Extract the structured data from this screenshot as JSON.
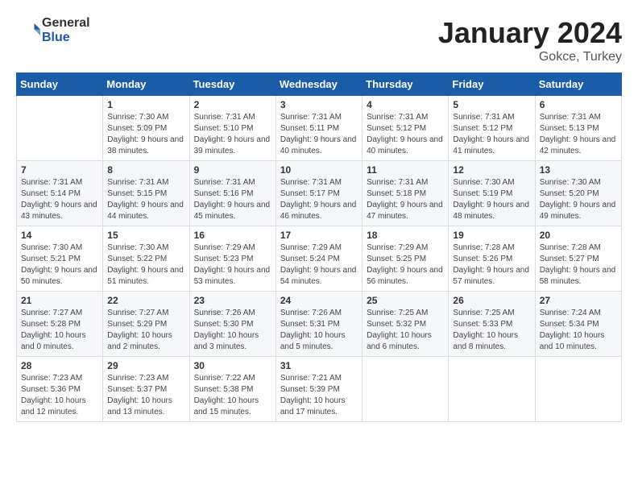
{
  "logo": {
    "general": "General",
    "blue": "Blue"
  },
  "header": {
    "month": "January 2024",
    "location": "Gokce, Turkey"
  },
  "weekdays": [
    "Sunday",
    "Monday",
    "Tuesday",
    "Wednesday",
    "Thursday",
    "Friday",
    "Saturday"
  ],
  "weeks": [
    [
      {
        "day": "",
        "sunrise": "",
        "sunset": "",
        "daylight": ""
      },
      {
        "day": "1",
        "sunrise": "Sunrise: 7:30 AM",
        "sunset": "Sunset: 5:09 PM",
        "daylight": "Daylight: 9 hours and 38 minutes."
      },
      {
        "day": "2",
        "sunrise": "Sunrise: 7:31 AM",
        "sunset": "Sunset: 5:10 PM",
        "daylight": "Daylight: 9 hours and 39 minutes."
      },
      {
        "day": "3",
        "sunrise": "Sunrise: 7:31 AM",
        "sunset": "Sunset: 5:11 PM",
        "daylight": "Daylight: 9 hours and 40 minutes."
      },
      {
        "day": "4",
        "sunrise": "Sunrise: 7:31 AM",
        "sunset": "Sunset: 5:12 PM",
        "daylight": "Daylight: 9 hours and 40 minutes."
      },
      {
        "day": "5",
        "sunrise": "Sunrise: 7:31 AM",
        "sunset": "Sunset: 5:12 PM",
        "daylight": "Daylight: 9 hours and 41 minutes."
      },
      {
        "day": "6",
        "sunrise": "Sunrise: 7:31 AM",
        "sunset": "Sunset: 5:13 PM",
        "daylight": "Daylight: 9 hours and 42 minutes."
      }
    ],
    [
      {
        "day": "7",
        "sunrise": "Sunrise: 7:31 AM",
        "sunset": "Sunset: 5:14 PM",
        "daylight": "Daylight: 9 hours and 43 minutes."
      },
      {
        "day": "8",
        "sunrise": "Sunrise: 7:31 AM",
        "sunset": "Sunset: 5:15 PM",
        "daylight": "Daylight: 9 hours and 44 minutes."
      },
      {
        "day": "9",
        "sunrise": "Sunrise: 7:31 AM",
        "sunset": "Sunset: 5:16 PM",
        "daylight": "Daylight: 9 hours and 45 minutes."
      },
      {
        "day": "10",
        "sunrise": "Sunrise: 7:31 AM",
        "sunset": "Sunset: 5:17 PM",
        "daylight": "Daylight: 9 hours and 46 minutes."
      },
      {
        "day": "11",
        "sunrise": "Sunrise: 7:31 AM",
        "sunset": "Sunset: 5:18 PM",
        "daylight": "Daylight: 9 hours and 47 minutes."
      },
      {
        "day": "12",
        "sunrise": "Sunrise: 7:30 AM",
        "sunset": "Sunset: 5:19 PM",
        "daylight": "Daylight: 9 hours and 48 minutes."
      },
      {
        "day": "13",
        "sunrise": "Sunrise: 7:30 AM",
        "sunset": "Sunset: 5:20 PM",
        "daylight": "Daylight: 9 hours and 49 minutes."
      }
    ],
    [
      {
        "day": "14",
        "sunrise": "Sunrise: 7:30 AM",
        "sunset": "Sunset: 5:21 PM",
        "daylight": "Daylight: 9 hours and 50 minutes."
      },
      {
        "day": "15",
        "sunrise": "Sunrise: 7:30 AM",
        "sunset": "Sunset: 5:22 PM",
        "daylight": "Daylight: 9 hours and 51 minutes."
      },
      {
        "day": "16",
        "sunrise": "Sunrise: 7:29 AM",
        "sunset": "Sunset: 5:23 PM",
        "daylight": "Daylight: 9 hours and 53 minutes."
      },
      {
        "day": "17",
        "sunrise": "Sunrise: 7:29 AM",
        "sunset": "Sunset: 5:24 PM",
        "daylight": "Daylight: 9 hours and 54 minutes."
      },
      {
        "day": "18",
        "sunrise": "Sunrise: 7:29 AM",
        "sunset": "Sunset: 5:25 PM",
        "daylight": "Daylight: 9 hours and 56 minutes."
      },
      {
        "day": "19",
        "sunrise": "Sunrise: 7:28 AM",
        "sunset": "Sunset: 5:26 PM",
        "daylight": "Daylight: 9 hours and 57 minutes."
      },
      {
        "day": "20",
        "sunrise": "Sunrise: 7:28 AM",
        "sunset": "Sunset: 5:27 PM",
        "daylight": "Daylight: 9 hours and 58 minutes."
      }
    ],
    [
      {
        "day": "21",
        "sunrise": "Sunrise: 7:27 AM",
        "sunset": "Sunset: 5:28 PM",
        "daylight": "Daylight: 10 hours and 0 minutes."
      },
      {
        "day": "22",
        "sunrise": "Sunrise: 7:27 AM",
        "sunset": "Sunset: 5:29 PM",
        "daylight": "Daylight: 10 hours and 2 minutes."
      },
      {
        "day": "23",
        "sunrise": "Sunrise: 7:26 AM",
        "sunset": "Sunset: 5:30 PM",
        "daylight": "Daylight: 10 hours and 3 minutes."
      },
      {
        "day": "24",
        "sunrise": "Sunrise: 7:26 AM",
        "sunset": "Sunset: 5:31 PM",
        "daylight": "Daylight: 10 hours and 5 minutes."
      },
      {
        "day": "25",
        "sunrise": "Sunrise: 7:25 AM",
        "sunset": "Sunset: 5:32 PM",
        "daylight": "Daylight: 10 hours and 6 minutes."
      },
      {
        "day": "26",
        "sunrise": "Sunrise: 7:25 AM",
        "sunset": "Sunset: 5:33 PM",
        "daylight": "Daylight: 10 hours and 8 minutes."
      },
      {
        "day": "27",
        "sunrise": "Sunrise: 7:24 AM",
        "sunset": "Sunset: 5:34 PM",
        "daylight": "Daylight: 10 hours and 10 minutes."
      }
    ],
    [
      {
        "day": "28",
        "sunrise": "Sunrise: 7:23 AM",
        "sunset": "Sunset: 5:36 PM",
        "daylight": "Daylight: 10 hours and 12 minutes."
      },
      {
        "day": "29",
        "sunrise": "Sunrise: 7:23 AM",
        "sunset": "Sunset: 5:37 PM",
        "daylight": "Daylight: 10 hours and 13 minutes."
      },
      {
        "day": "30",
        "sunrise": "Sunrise: 7:22 AM",
        "sunset": "Sunset: 5:38 PM",
        "daylight": "Daylight: 10 hours and 15 minutes."
      },
      {
        "day": "31",
        "sunrise": "Sunrise: 7:21 AM",
        "sunset": "Sunset: 5:39 PM",
        "daylight": "Daylight: 10 hours and 17 minutes."
      },
      {
        "day": "",
        "sunrise": "",
        "sunset": "",
        "daylight": ""
      },
      {
        "day": "",
        "sunrise": "",
        "sunset": "",
        "daylight": ""
      },
      {
        "day": "",
        "sunrise": "",
        "sunset": "",
        "daylight": ""
      }
    ]
  ]
}
